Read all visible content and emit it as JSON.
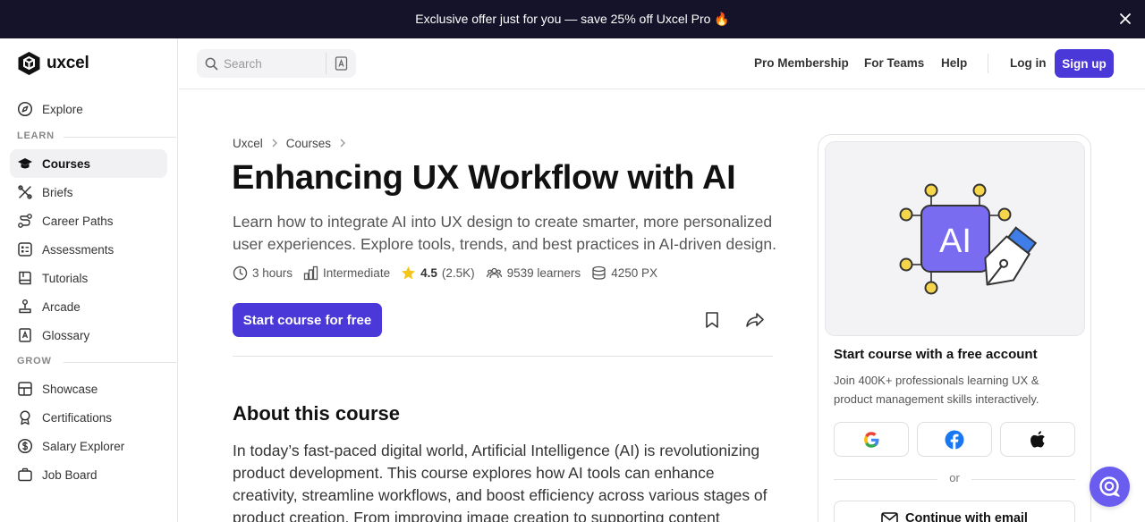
{
  "promo": {
    "text": "Exclusive offer just for you — save 25% off Uxcel Pro 🔥"
  },
  "brand": {
    "name": "uxcel",
    "accent": "#4b38d9"
  },
  "sidebar": {
    "explore": "Explore",
    "learn_label": "LEARN",
    "learn_items": [
      "Courses",
      "Briefs",
      "Career Paths",
      "Assessments",
      "Tutorials",
      "Arcade",
      "Glossary"
    ],
    "active_item": "Courses",
    "grow_label": "GROW",
    "grow_items": [
      "Showcase",
      "Certifications",
      "Salary Explorer",
      "Job Board"
    ]
  },
  "header": {
    "search_placeholder": "Search",
    "links": [
      "Pro Membership",
      "For Teams",
      "Help"
    ],
    "login": "Log in",
    "signup": "Sign up"
  },
  "breadcrumb": [
    "Uxcel",
    "Courses"
  ],
  "course": {
    "title": "Enhancing UX Workflow with AI",
    "subtitle": "Learn how to integrate AI into UX design to create smarter, more personalized user experiences. Explore tools, trends, and best practices in AI-driven design.",
    "duration": "3 hours",
    "level": "Intermediate",
    "rating": "4.5",
    "rating_count": "(2.5K)",
    "learners": "9539 learners",
    "px": "4250 PX",
    "start_button": "Start course for free",
    "about_heading": "About this course",
    "about_text": "In today’s fast-paced digital world, Artificial Intelligence (AI) is revolutionizing product development. This course explores how AI tools can enhance creativity, streamline workflows, and boost efficiency across various stages of product creation. From improving image creation to supporting content"
  },
  "signup_card": {
    "art_label": "AI",
    "heading": "Start course with a free account",
    "text": "Join 400K+ professionals learning UX & product management skills interactively.",
    "or": "or",
    "email_button": "Continue with email",
    "social": [
      "google-icon",
      "facebook-icon",
      "apple-icon"
    ]
  }
}
